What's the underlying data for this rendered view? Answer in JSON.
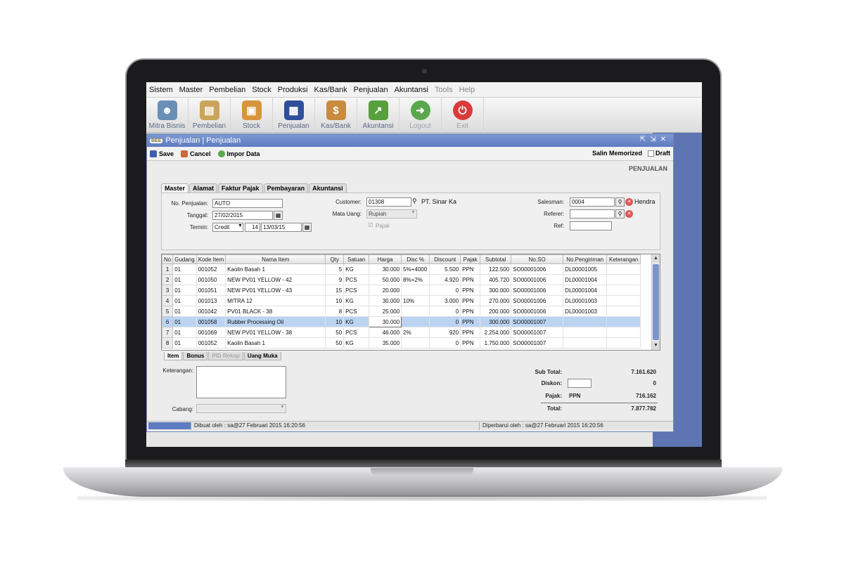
{
  "menu": [
    "Sistem",
    "Master",
    "Pembelian",
    "Stock",
    "Produksi",
    "Kas/Bank",
    "Penjualan",
    "Akuntansi",
    "Tools",
    "Help"
  ],
  "toolbar": [
    {
      "label": "Mitra Bisnis",
      "icon": "people-icon",
      "color": "#6a8fb7"
    },
    {
      "label": "Pembelian",
      "icon": "receipt-icon",
      "color": "#c9a45a"
    },
    {
      "label": "Stock",
      "icon": "boxes-icon",
      "color": "#d6953c"
    },
    {
      "label": "Penjualan",
      "icon": "shopping-bag-icon",
      "color": "#2f4f9c"
    },
    {
      "label": "Kas/Bank",
      "icon": "money-bag-icon",
      "color": "#c98b3d"
    },
    {
      "label": "Akuntansi",
      "icon": "growth-chart-icon",
      "color": "#57a03f"
    },
    {
      "label": "Logout",
      "icon": "logout-icon",
      "color": "#5aa84e"
    },
    {
      "label": "Exit",
      "icon": "power-icon",
      "color": "#d93b3b"
    }
  ],
  "window": {
    "title": "Penjualan | Penjualan",
    "logo": "BEE",
    "save_label": "Save",
    "cancel_label": "Cancel",
    "import_label": "Impor Data",
    "salin_label": "Salin Memorized",
    "draft_label": "Draft",
    "form_title": "PENJUALAN"
  },
  "tabs": [
    "Master",
    "Alamat",
    "Faktur Pajak",
    "Pembayaran",
    "Akuntansi"
  ],
  "master": {
    "no_penjualan_label": "No. Penjualan:",
    "no_penjualan": "AUTO",
    "tanggal_label": "Tanggal:",
    "tanggal": "27/02/2015",
    "termin_label": "Termin:",
    "termin": "Credit",
    "termin_days": "14",
    "termin_date": "13/03/15",
    "customer_label": "Customer:",
    "customer_code": "01308",
    "customer_name": "PT. Sinar Ka",
    "mata_uang_label": "Mata Uang:",
    "mata_uang": "Rupiah",
    "pajak_label": "Pajak",
    "salesman_label": "Salesman:",
    "salesman_code": "0004",
    "salesman_name": "Hendra",
    "referer_label": "Referer:",
    "referer": "",
    "ref_label": "Ref:",
    "ref": ""
  },
  "columns": [
    "No",
    "Gudang",
    "Kode Item",
    "Nama Item",
    "Qty",
    "Satuan",
    "Harga",
    "Disc %",
    "Discount",
    "Pajak",
    "Subtotal",
    "No.SO",
    "No.Pengiriman",
    "Keterangan"
  ],
  "rows": [
    [
      "1",
      "01",
      "001052",
      "Kaolin Basah 1",
      "5",
      "KG",
      "30.000",
      "5%+4000",
      "5.500",
      "PPN",
      "122.500",
      "SO00001006",
      "DL00001005",
      ""
    ],
    [
      "2",
      "01",
      "001050",
      "NEW PV01 YELLOW - 42",
      "9",
      "PCS",
      "50.000",
      "8%+2%",
      "4.920",
      "PPN",
      "405.720",
      "SO00001006",
      "DL00001004",
      ""
    ],
    [
      "3",
      "01",
      "001051",
      "NEW PV01 YELLOW - 43",
      "15",
      "PCS",
      "20.000",
      "",
      "0",
      "PPN",
      "300.000",
      "SO00001006",
      "DL00001004",
      ""
    ],
    [
      "4",
      "01",
      "001013",
      "MITRA 12",
      "10",
      "KG",
      "30.000",
      "10%",
      "3.000",
      "PPN",
      "270.000",
      "SO00001006",
      "DL00001003",
      ""
    ],
    [
      "5",
      "01",
      "001042",
      "PV01 BLACK - 38",
      "8",
      "PCS",
      "25.000",
      "",
      "0",
      "PPN",
      "200.000",
      "SO00001006",
      "DL00001003",
      ""
    ],
    [
      "6",
      "01",
      "001058",
      "Rubber Processing Oil",
      "10",
      "KG",
      "30.000",
      "",
      "0",
      "PPN",
      "300.000",
      "SO00001007",
      "",
      ""
    ],
    [
      "7",
      "01",
      "001069",
      "NEW PV01 YELLOW - 38",
      "50",
      "PCS",
      "46.000",
      "2%",
      "920",
      "PPN",
      "2.254.000",
      "SO00001007",
      "",
      ""
    ],
    [
      "8",
      "01",
      "001052",
      "Kaolin Basah 1",
      "50",
      "KG",
      "35.000",
      "",
      "0",
      "PPN",
      "1.750.000",
      "SO00001007",
      "",
      ""
    ]
  ],
  "selected_row": 5,
  "subtabs": [
    "Item",
    "Bonus",
    "PID Rekap",
    "Uang Muka"
  ],
  "lower": {
    "keterangan_label": "Keterangan:",
    "cabang_label": "Cabang:",
    "subtotal_label": "Sub Total:",
    "subtotal": "7.161.620",
    "diskon_label": "Diskon:",
    "diskon": "0",
    "pajak_label": "Pajak:",
    "pajak_type": "PPN",
    "pajak": "716.162",
    "total_label": "Total:",
    "total": "7.877.782"
  },
  "status": {
    "created": "Dibuat oleh : sa@27 Februari 2015  16:20:56",
    "updated": "Diperbarui oleh : sa@27 Februari 2015  16:20:56"
  }
}
